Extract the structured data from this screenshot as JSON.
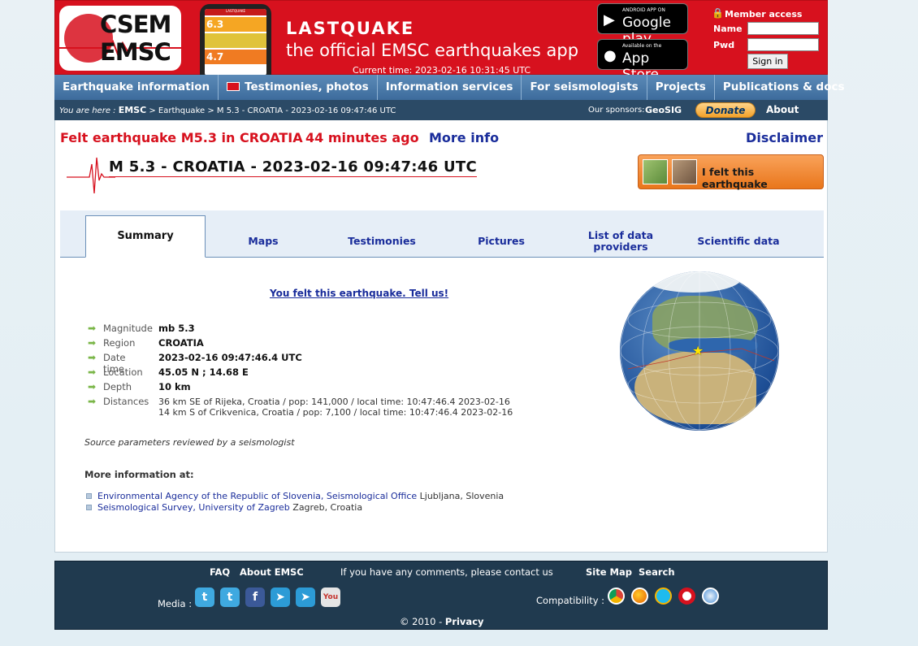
{
  "header": {
    "logo_top": "CSEM",
    "logo_bottom": "EMSC",
    "app_title": "LASTQUAKE",
    "app_subtitle": "the official EMSC earthquakes app",
    "current_time": "Current time: 2023-02-16 10:31:45 UTC",
    "phone_title": "LASTQUAKE",
    "phone_mags": [
      "6.3",
      "4.7"
    ],
    "google_small": "ANDROID APP ON",
    "google_big": "Google play",
    "apple_small": "Available on the",
    "apple_big": "App Store",
    "member_title": "Member access",
    "name_label": "Name",
    "pwd_label": "Pwd",
    "signin_label": "Sign in"
  },
  "nav": [
    "Earthquake information",
    "Testimonies, photos",
    "Information services",
    "For seismologists",
    "Projects",
    "Publications & docs"
  ],
  "breadcrumb": {
    "prefix": "You are here :",
    "root": "EMSC",
    "trail": "> Earthquake > M 5.3 - CROATIA - 2023-02-16 09:47:46 UTC",
    "sponsors_label": "Our sponsors:",
    "sponsor": "GeoSIG",
    "donate": "Donate",
    "about": "About EMSC"
  },
  "event": {
    "felt_title": "Felt earthquake M5.3 in CROATIA",
    "ago": "44 minutes ago",
    "more_info": "More info",
    "disclaimer": "Disclaimer",
    "title": "M 5.3 - CROATIA - 2023-02-16 09:47:46 UTC",
    "felt_button": "I felt this earthquake",
    "you_felt": "You felt this earthquake. Tell us!"
  },
  "tabs": [
    "Summary",
    "Maps",
    "Testimonies",
    "Pictures",
    "List of data providers",
    "Scientific data"
  ],
  "params": [
    {
      "k": "Magnitude",
      "v": "mb 5.3"
    },
    {
      "k": "Region",
      "v": "CROATIA"
    },
    {
      "k": "Date time",
      "v": "2023-02-16 09:47:46.4 UTC"
    },
    {
      "k": "Location",
      "v": "45.05 N ; 14.68 E"
    },
    {
      "k": "Depth",
      "v": "10 km"
    },
    {
      "k": "Distances",
      "v": ""
    }
  ],
  "distances": [
    "36 km SE of Rijeka, Croatia / pop: 141,000 / local time: 10:47:46.4 2023-02-16",
    "14 km S of Crikvenica, Croatia / pop: 7,100 / local time: 10:47:46.4 2023-02-16"
  ],
  "reviewed": "Source parameters reviewed by a seismologist",
  "more_info_at": "More information at:",
  "providers": [
    {
      "name": "Environmental Agency of the Republic of Slovenia, Seismological Office",
      "place": " Ljubljana, Slovenia"
    },
    {
      "name": "Seismological Survey, University of Zagreb",
      "place": " Zagreb, Croatia"
    }
  ],
  "footer": {
    "faq": "FAQ",
    "about": "About EMSC",
    "comments": "If you have any comments, please contact us",
    "sitemap": "Site Map",
    "search": "Search",
    "media": "Media :",
    "compat": "Compatibility :",
    "copyright": "© 2010 -",
    "privacy": "Privacy"
  },
  "colors": {
    "brand_red": "#d7111e",
    "nav_blue": "#4a78a8",
    "link_blue": "#1a2d9b",
    "footer": "#203a4f"
  }
}
